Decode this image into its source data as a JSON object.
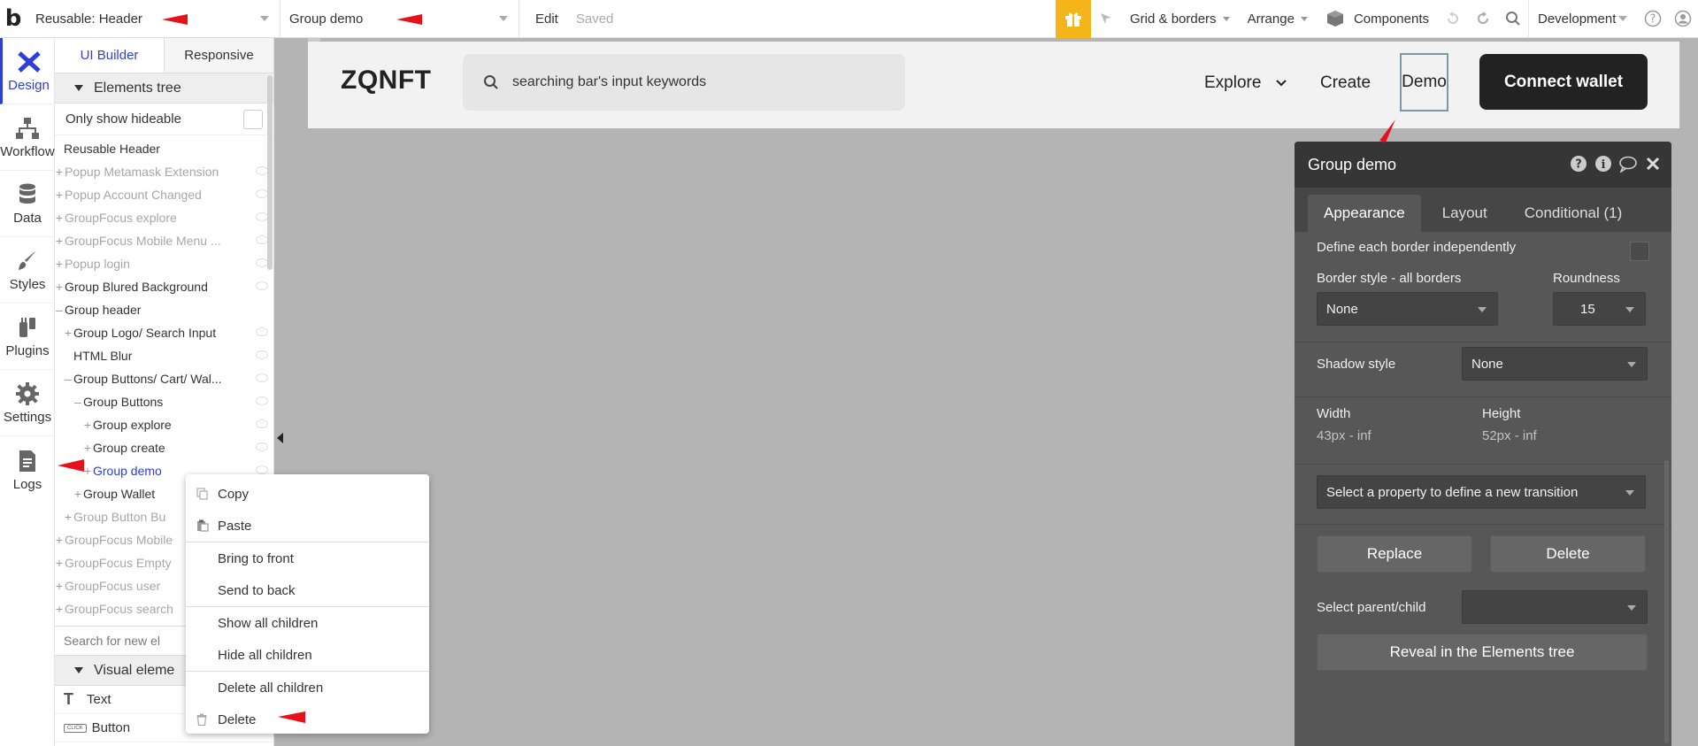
{
  "topbar": {
    "page_select": "Reusable: Header",
    "element_select": "Group demo",
    "edit_label": "Edit",
    "saved_label": "Saved",
    "grid_label": "Grid & borders",
    "arrange_label": "Arrange",
    "components_label": "Components",
    "env_select": "Development"
  },
  "rail": {
    "items": [
      {
        "label": "Design"
      },
      {
        "label": "Workflow"
      },
      {
        "label": "Data"
      },
      {
        "label": "Styles"
      },
      {
        "label": "Plugins"
      },
      {
        "label": "Settings"
      },
      {
        "label": "Logs"
      }
    ]
  },
  "panel": {
    "tab_ui_builder": "UI Builder",
    "tab_responsive": "Responsive",
    "elements_tree_title": "Elements tree",
    "only_show_hideable": "Only show hideable",
    "tree": [
      {
        "label": "Reusable Header"
      },
      {
        "label": "Popup Metamask Extension"
      },
      {
        "label": "Popup Account Changed"
      },
      {
        "label": "GroupFocus explore"
      },
      {
        "label": "GroupFocus Mobile Menu ..."
      },
      {
        "label": "Popup login"
      },
      {
        "label": "Group Blured Background"
      },
      {
        "label": "Group header"
      },
      {
        "label": "Group Logo/ Search Input"
      },
      {
        "label": "HTML Blur"
      },
      {
        "label": "Group Buttons/ Cart/ Wal..."
      },
      {
        "label": "Group Buttons"
      },
      {
        "label": "Group explore"
      },
      {
        "label": "Group create"
      },
      {
        "label": "Group demo"
      },
      {
        "label": "Group Wallet"
      },
      {
        "label": "Group Button Bu"
      },
      {
        "label": "GroupFocus Mobile"
      },
      {
        "label": "GroupFocus Empty"
      },
      {
        "label": "GroupFocus user"
      },
      {
        "label": "GroupFocus search"
      }
    ],
    "search_placeholder": "Search for new el",
    "visual_elements_title": "Visual eleme",
    "visual": [
      {
        "label": "Text",
        "icon": "T"
      },
      {
        "label": "Button",
        "icon": "CLICK"
      }
    ]
  },
  "canvas": {
    "brand": "ZQNFT",
    "search_text": "searching bar's input keywords",
    "nav_explore": "Explore",
    "nav_create": "Create",
    "nav_demo": "Demo",
    "connect_wallet": "Connect wallet"
  },
  "editor": {
    "title": "Group demo",
    "tabs": [
      "Appearance",
      "Layout",
      "Conditional (1)"
    ],
    "define_border": "Define each border independently",
    "border_style_label": "Border style - all borders",
    "roundness_label": "Roundness",
    "border_style_value": "None",
    "roundness_value": "15",
    "shadow_label": "Shadow style",
    "shadow_value": "None",
    "width_label": "Width",
    "height_label": "Height",
    "width_value": "43px - inf",
    "height_value": "52px - inf",
    "transition_select": "Select a property to define a new transition",
    "replace_btn": "Replace",
    "delete_btn": "Delete",
    "parent_label": "Select parent/child",
    "reveal_btn": "Reveal in the Elements tree"
  },
  "context_menu": {
    "copy": "Copy",
    "paste": "Paste",
    "bring_front": "Bring to front",
    "send_back": "Send to back",
    "show_children": "Show all children",
    "hide_children": "Hide all children",
    "delete_children": "Delete all children",
    "delete": "Delete"
  },
  "colors": {
    "accent": "#2d3ed9",
    "gift": "#f4b41a",
    "annotation": "#e8111a"
  }
}
